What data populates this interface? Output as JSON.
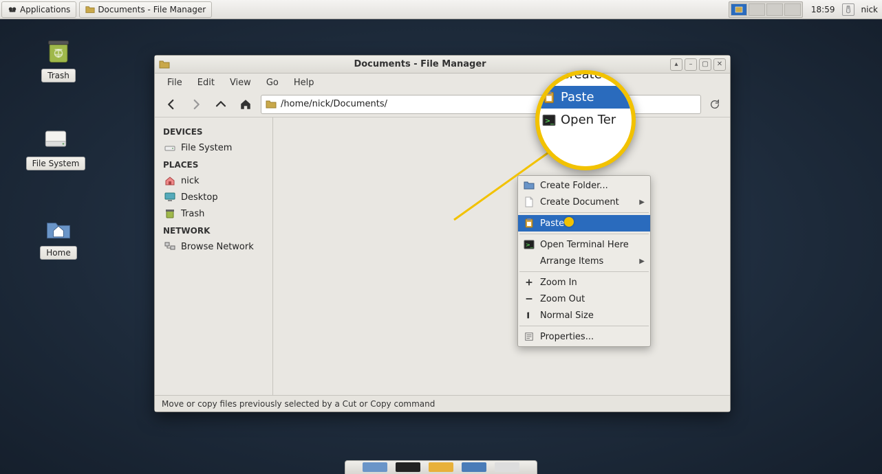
{
  "panel": {
    "applications_label": "Applications",
    "taskbar_item": "Documents - File Manager",
    "clock": "18:59",
    "user": "nick"
  },
  "desktop": {
    "trash": "Trash",
    "filesystem": "File System",
    "home": "Home"
  },
  "window": {
    "title": "Documents - File Manager",
    "menus": {
      "file": "File",
      "edit": "Edit",
      "view": "View",
      "go": "Go",
      "help": "Help"
    },
    "path": "/home/nick/Documents/",
    "sidebar": {
      "devices_hdr": "DEVICES",
      "places_hdr": "PLACES",
      "network_hdr": "NETWORK",
      "file_system": "File System",
      "nick": "nick",
      "desktop": "Desktop",
      "trash": "Trash",
      "browse_network": "Browse Network"
    },
    "status": "Move or copy files previously selected by a Cut or Copy command"
  },
  "context_menu": {
    "create_folder": "Create Folder...",
    "create_document": "Create Document",
    "paste": "Paste",
    "open_terminal": "Open Terminal Here",
    "arrange": "Arrange Items",
    "zoom_in": "Zoom In",
    "zoom_out": "Zoom Out",
    "normal_size": "Normal Size",
    "properties": "Properties..."
  },
  "callout": {
    "row1": "Create D",
    "row2": "Paste",
    "row3": "Open Ter"
  }
}
